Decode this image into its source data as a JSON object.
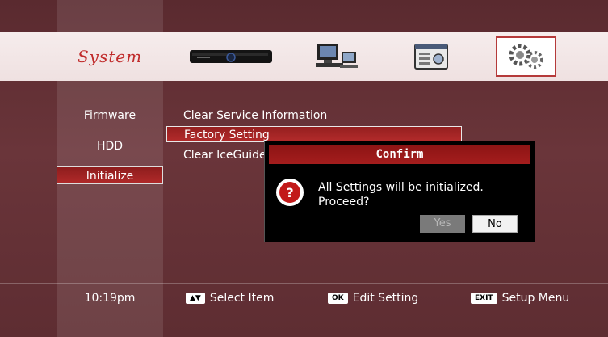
{
  "header": {
    "title": "System",
    "tiles": [
      {
        "name": "set-top-box",
        "label": "Device"
      },
      {
        "name": "network-pcs",
        "label": "Network"
      },
      {
        "name": "settings-window",
        "label": "Settings"
      },
      {
        "name": "gears",
        "label": "System"
      }
    ]
  },
  "left_menu": {
    "items": [
      "Firmware",
      "HDD",
      "Initialize"
    ],
    "selected": "Initialize"
  },
  "options": {
    "items": [
      "Clear Service Information",
      "Factory Setting",
      "Clear IceGuide"
    ],
    "selected": "Factory Setting"
  },
  "dialog": {
    "title": "Confirm",
    "message_line1": "All Settings will be initialized.",
    "message_line2": "Proceed?",
    "yes_label": "Yes",
    "no_label": "No"
  },
  "footer": {
    "time": "10:19pm",
    "hint1_key": "▲▼",
    "hint1_text": "Select Item",
    "hint2_key": "OK",
    "hint2_text": "Edit Setting",
    "hint3_key": "EXIT",
    "hint3_text": "Setup Menu"
  }
}
